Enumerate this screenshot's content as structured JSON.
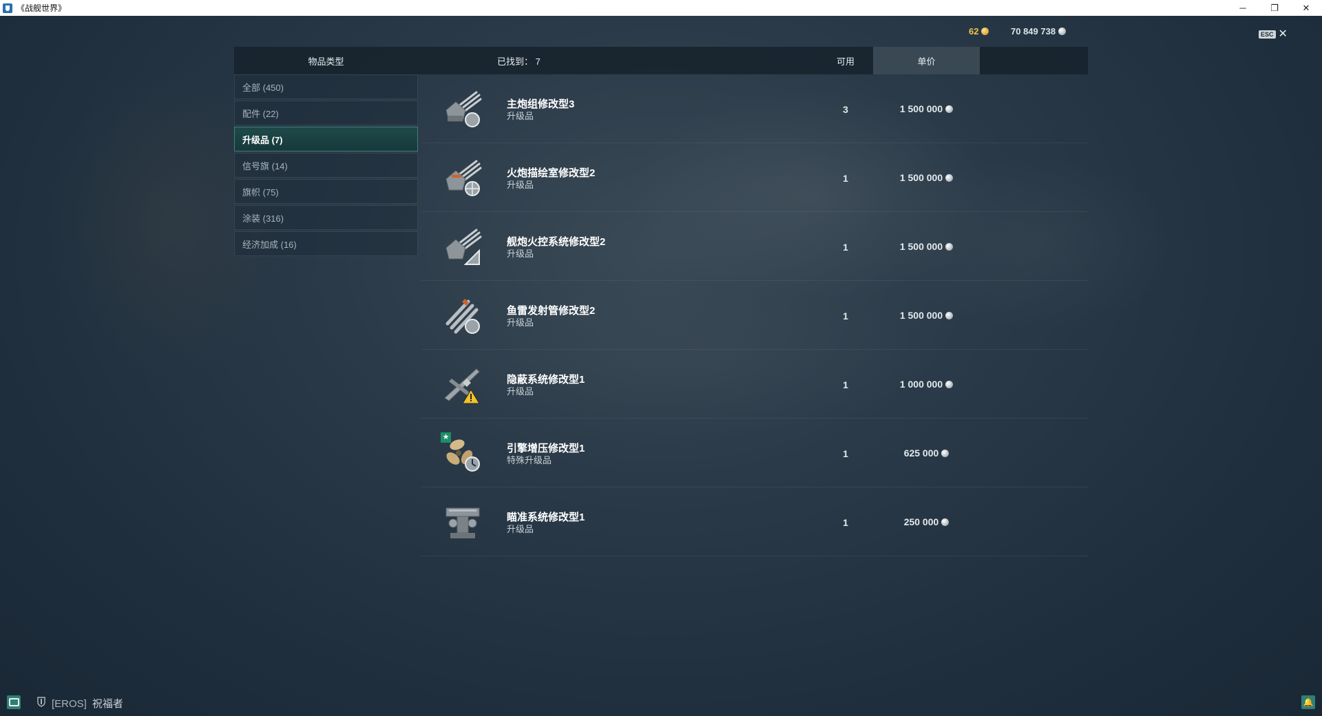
{
  "window": {
    "title": "《战舰世界》",
    "minimize_glyph": "─",
    "restore_glyph": "❐",
    "close_glyph": "✕"
  },
  "currency": {
    "doubloons": "62",
    "credits": "70 849 738",
    "doubloon_icon": "gold-coin-icon",
    "credit_icon": "silver-coin-icon"
  },
  "esc": {
    "key_label": "ESC",
    "close_glyph": "✕"
  },
  "header": {
    "item_type": "物品类型",
    "found": "已找到： 7",
    "available": "可用",
    "unit_price": "单价"
  },
  "sidebar": {
    "items": [
      {
        "label": "全部 (450)",
        "active": false
      },
      {
        "label": "配件 (22)",
        "active": false
      },
      {
        "label": "升级品 (7)",
        "active": true
      },
      {
        "label": "信号旗 (14)",
        "active": false
      },
      {
        "label": "旗帜 (75)",
        "active": false
      },
      {
        "label": "涂装 (316)",
        "active": false
      },
      {
        "label": "经济加成 (16)",
        "active": false
      }
    ]
  },
  "items": [
    {
      "name": "主炮组修改型3",
      "type": "升级品",
      "available": "3",
      "price": "1 500 000",
      "icon": "main-battery-icon"
    },
    {
      "name": "火炮描绘室修改型2",
      "type": "升级品",
      "available": "1",
      "price": "1 500 000",
      "icon": "gun-fire-control-icon"
    },
    {
      "name": "舰炮火控系统修改型2",
      "type": "升级品",
      "available": "1",
      "price": "1 500 000",
      "icon": "fire-control-system-icon"
    },
    {
      "name": "鱼雷发射管修改型2",
      "type": "升级品",
      "available": "1",
      "price": "1 500 000",
      "icon": "torpedo-tubes-icon"
    },
    {
      "name": "隐蔽系统修改型1",
      "type": "升级品",
      "available": "1",
      "price": "1 000 000",
      "icon": "concealment-icon"
    },
    {
      "name": "引擎增压修改型1",
      "type": "特殊升级品",
      "available": "1",
      "price": "625 000",
      "icon": "engine-boost-icon"
    },
    {
      "name": "瞄准系统修改型1",
      "type": "升级品",
      "available": "1",
      "price": "250 000",
      "icon": "aiming-system-icon"
    }
  ],
  "bottom": {
    "clan_tag": "[EROS]",
    "player_name": "祝福者",
    "bell_glyph": "🔔"
  }
}
